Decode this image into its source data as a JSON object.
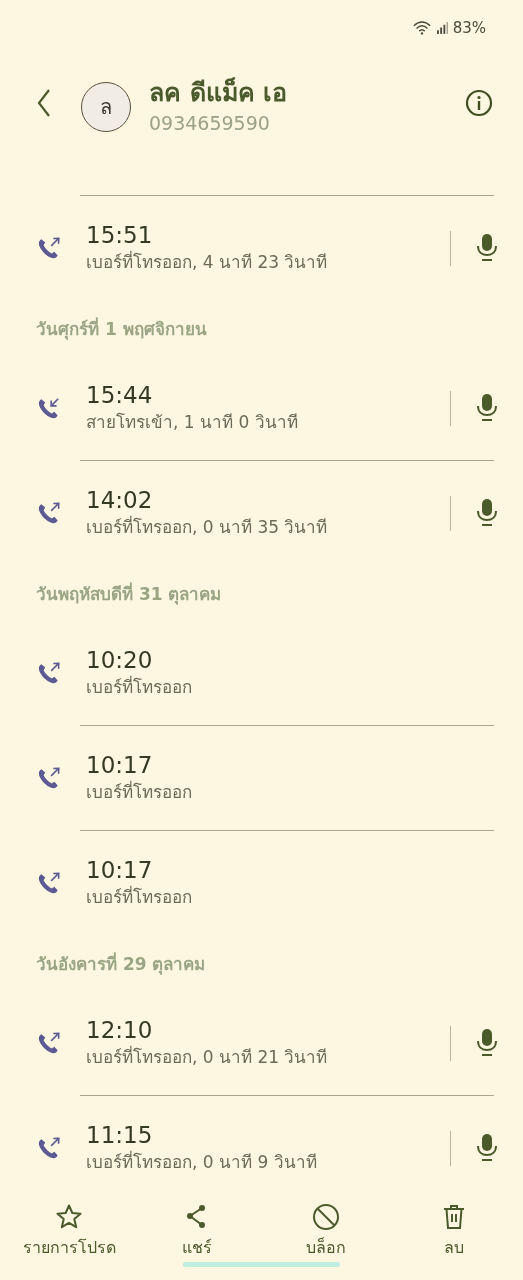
{
  "status_bar": {
    "battery": "83%"
  },
  "contact": {
    "initial": "ล",
    "name": "ลค ดีแม็ค เอ",
    "number": "0934659590"
  },
  "groups": [
    {
      "calls": [
        {
          "kind": "outgoing",
          "time": "15:51",
          "detail": "เบอร์ที่โทรออก, 4 นาที 23 วินาที",
          "recording": true
        }
      ]
    },
    {
      "date": "วันศุกร์ที่ 1 พฤศจิกายน",
      "calls": [
        {
          "kind": "incoming",
          "time": "15:44",
          "detail": "สายโทรเข้า, 1 นาที 0 วินาที",
          "recording": true
        },
        {
          "kind": "outgoing",
          "time": "14:02",
          "detail": "เบอร์ที่โทรออก, 0 นาที 35 วินาที",
          "recording": true
        }
      ]
    },
    {
      "date": "วันพฤหัสบดีที่ 31 ตุลาคม",
      "calls": [
        {
          "kind": "outgoing",
          "time": "10:20",
          "detail": "เบอร์ที่โทรออก",
          "recording": false
        },
        {
          "kind": "outgoing",
          "time": "10:17",
          "detail": "เบอร์ที่โทรออก",
          "recording": false
        },
        {
          "kind": "outgoing",
          "time": "10:17",
          "detail": "เบอร์ที่โทรออก",
          "recording": false
        }
      ]
    },
    {
      "date": "วันอังคารที่ 29 ตุลาคม",
      "calls": [
        {
          "kind": "outgoing",
          "time": "12:10",
          "detail": "เบอร์ที่โทรออก, 0 นาที 21 วินาที",
          "recording": true
        },
        {
          "kind": "outgoing",
          "time": "11:15",
          "detail": "เบอร์ที่โทรออก, 0 นาที 9 วินาที",
          "recording": true
        }
      ]
    }
  ],
  "bottom_actions": [
    {
      "kind": "favorite",
      "label": "รายการโปรด"
    },
    {
      "kind": "share",
      "label": "แชร์"
    },
    {
      "kind": "block",
      "label": "บล็อก"
    },
    {
      "kind": "delete",
      "label": "ลบ"
    }
  ]
}
